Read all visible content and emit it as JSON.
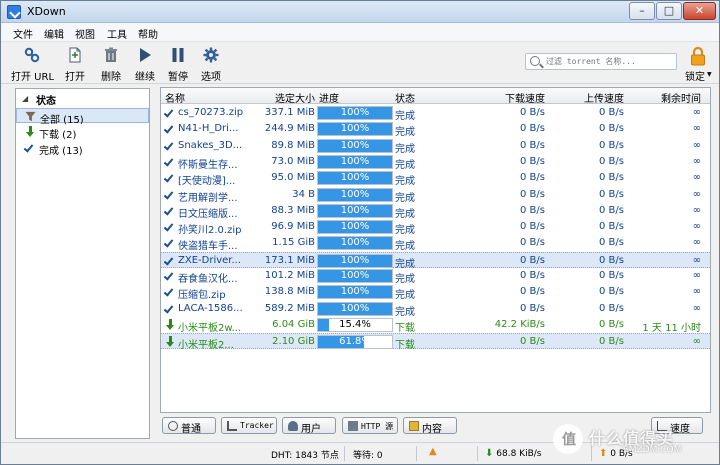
{
  "window": {
    "title": "XDown",
    "min_glyph": "–",
    "max_glyph": "□",
    "close_glyph": "✕"
  },
  "menu": [
    "文件",
    "编辑",
    "视图",
    "工具",
    "帮助"
  ],
  "toolbar": {
    "open_url": "打开 URL",
    "open": "打开",
    "delete": "删除",
    "resume": "继续",
    "pause": "暂停",
    "options": "选项",
    "lock": "锁定"
  },
  "search": {
    "placeholder": "过滤 torrent 名称..."
  },
  "sidebar": {
    "heading": "状态",
    "items": [
      {
        "label": "全部 (15)",
        "icon": "filter-icon"
      },
      {
        "label": "下载 (2)",
        "icon": "download-arrow-icon"
      },
      {
        "label": "完成 (13)",
        "icon": "check-icon"
      }
    ]
  },
  "table": {
    "columns": [
      "名称",
      "选定大小",
      "进度",
      "状态",
      "下载速度",
      "上传速度",
      "剩余时间"
    ],
    "rows": [
      {
        "name": "cs_70273.zip",
        "size": "337.1 MiB",
        "progress": 100,
        "progress_label": "100%",
        "status": "完成",
        "dl": "0 B/s",
        "ul": "0 B/s",
        "eta": "∞",
        "kind": "done"
      },
      {
        "name": "N41-H_Dri...",
        "size": "244.9 MiB",
        "progress": 100,
        "progress_label": "100%",
        "status": "完成",
        "dl": "0 B/s",
        "ul": "0 B/s",
        "eta": "∞",
        "kind": "done"
      },
      {
        "name": "Snakes_3D...",
        "size": "89.8 MiB",
        "progress": 100,
        "progress_label": "100%",
        "status": "完成",
        "dl": "0 B/s",
        "ul": "0 B/s",
        "eta": "∞",
        "kind": "done"
      },
      {
        "name": "怀斯曼生存...",
        "size": "73.0 MiB",
        "progress": 100,
        "progress_label": "100%",
        "status": "完成",
        "dl": "0 B/s",
        "ul": "0 B/s",
        "eta": "∞",
        "kind": "done"
      },
      {
        "name": "[天使动漫]...",
        "size": "95.0 MiB",
        "progress": 100,
        "progress_label": "100%",
        "status": "完成",
        "dl": "0 B/s",
        "ul": "0 B/s",
        "eta": "∞",
        "kind": "done"
      },
      {
        "name": "艺用解剖学...",
        "size": "34 B",
        "progress": 100,
        "progress_label": "100%",
        "status": "完成",
        "dl": "0 B/s",
        "ul": "0 B/s",
        "eta": "∞",
        "kind": "done"
      },
      {
        "name": "日文压缩版...",
        "size": "88.3 MiB",
        "progress": 100,
        "progress_label": "100%",
        "status": "完成",
        "dl": "0 B/s",
        "ul": "0 B/s",
        "eta": "∞",
        "kind": "done"
      },
      {
        "name": "孙笑川2.0.zip",
        "size": "96.9 MiB",
        "progress": 100,
        "progress_label": "100%",
        "status": "完成",
        "dl": "0 B/s",
        "ul": "0 B/s",
        "eta": "∞",
        "kind": "done"
      },
      {
        "name": "侠盗猎车手...",
        "size": "1.15 GiB",
        "progress": 100,
        "progress_label": "100%",
        "status": "完成",
        "dl": "0 B/s",
        "ul": "0 B/s",
        "eta": "∞",
        "kind": "done"
      },
      {
        "name": "ZXE-Driver...",
        "size": "173.1 MiB",
        "progress": 100,
        "progress_label": "100%",
        "status": "完成",
        "dl": "0 B/s",
        "ul": "0 B/s",
        "eta": "∞",
        "kind": "done",
        "selected": true
      },
      {
        "name": "吞食鱼汉化...",
        "size": "101.2 MiB",
        "progress": 100,
        "progress_label": "100%",
        "status": "完成",
        "dl": "0 B/s",
        "ul": "0 B/s",
        "eta": "∞",
        "kind": "done"
      },
      {
        "name": "压缩包.zip",
        "size": "138.8 MiB",
        "progress": 100,
        "progress_label": "100%",
        "status": "完成",
        "dl": "0 B/s",
        "ul": "0 B/s",
        "eta": "∞",
        "kind": "done"
      },
      {
        "name": "LACA-1586...",
        "size": "589.2 MiB",
        "progress": 100,
        "progress_label": "100%",
        "status": "完成",
        "dl": "0 B/s",
        "ul": "0 B/s",
        "eta": "∞",
        "kind": "done"
      },
      {
        "name": "小米平板2w...",
        "size": "6.04 GiB",
        "progress": 15.4,
        "progress_label": "15.4%",
        "status": "下载",
        "dl": "42.2 KiB/s",
        "ul": "0 B/s",
        "eta": "1 天 11 小时",
        "kind": "dl"
      },
      {
        "name": "小米平板2...",
        "size": "2.10 GiB",
        "progress": 61.8,
        "progress_label": "61.8%",
        "status": "下载",
        "dl": "0 B/s",
        "ul": "0 B/s",
        "eta": "∞",
        "kind": "dl",
        "selected": true
      }
    ]
  },
  "tabs": [
    {
      "label": "普通",
      "icon": "general-icon"
    },
    {
      "label": "Tracker",
      "icon": "tracker-icon"
    },
    {
      "label": "用户",
      "icon": "peers-icon"
    },
    {
      "label": "HTTP 源",
      "icon": "http-source-icon"
    },
    {
      "label": "内容",
      "icon": "content-folder-icon"
    },
    {
      "label": "速度",
      "icon": "speed-graph-icon"
    }
  ],
  "statusbar": {
    "dht": "DHT: 1843 节点",
    "waiting": "等待: 0",
    "down_speed": "68.8 KiB/s",
    "up_speed": "0 B/s"
  },
  "watermark": {
    "text": "值 什么值得买",
    "brand_text": "SMZDM.COM"
  },
  "colors": {
    "accent": "#3596e6",
    "done_text": "#12428f",
    "downloading_text": "#2b8a16"
  }
}
